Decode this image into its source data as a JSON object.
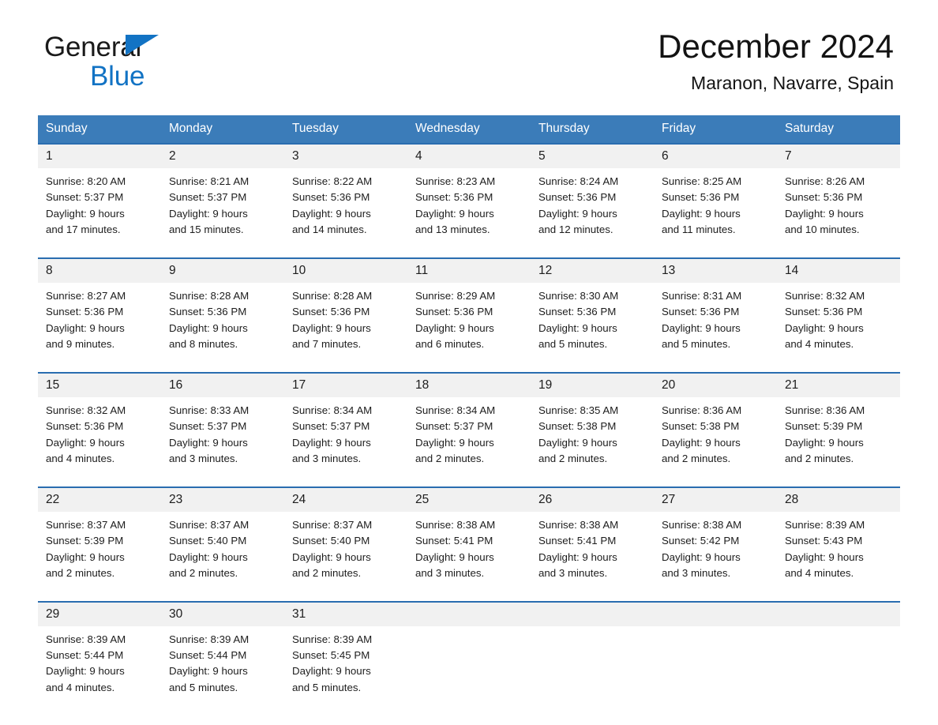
{
  "brand": {
    "name_part1": "General",
    "name_part2": "Blue",
    "logo_icon": "triangle-logo-icon"
  },
  "header": {
    "month_title": "December 2024",
    "location": "Maranon, Navarre, Spain"
  },
  "theme": {
    "header_blue": "#3b7cb9",
    "rule_blue": "#2a6db0",
    "daynum_band": "#f1f1f1",
    "brand_blue": "#1273c4",
    "text": "#1d1d1d"
  },
  "calendar": {
    "weekday_headers": [
      "Sunday",
      "Monday",
      "Tuesday",
      "Wednesday",
      "Thursday",
      "Friday",
      "Saturday"
    ],
    "weeks": [
      {
        "days": [
          {
            "num": "1",
            "sunrise": "Sunrise: 8:20 AM",
            "sunset": "Sunset: 5:37 PM",
            "daylight1": "Daylight: 9 hours",
            "daylight2": "and 17 minutes."
          },
          {
            "num": "2",
            "sunrise": "Sunrise: 8:21 AM",
            "sunset": "Sunset: 5:37 PM",
            "daylight1": "Daylight: 9 hours",
            "daylight2": "and 15 minutes."
          },
          {
            "num": "3",
            "sunrise": "Sunrise: 8:22 AM",
            "sunset": "Sunset: 5:36 PM",
            "daylight1": "Daylight: 9 hours",
            "daylight2": "and 14 minutes."
          },
          {
            "num": "4",
            "sunrise": "Sunrise: 8:23 AM",
            "sunset": "Sunset: 5:36 PM",
            "daylight1": "Daylight: 9 hours",
            "daylight2": "and 13 minutes."
          },
          {
            "num": "5",
            "sunrise": "Sunrise: 8:24 AM",
            "sunset": "Sunset: 5:36 PM",
            "daylight1": "Daylight: 9 hours",
            "daylight2": "and 12 minutes."
          },
          {
            "num": "6",
            "sunrise": "Sunrise: 8:25 AM",
            "sunset": "Sunset: 5:36 PM",
            "daylight1": "Daylight: 9 hours",
            "daylight2": "and 11 minutes."
          },
          {
            "num": "7",
            "sunrise": "Sunrise: 8:26 AM",
            "sunset": "Sunset: 5:36 PM",
            "daylight1": "Daylight: 9 hours",
            "daylight2": "and 10 minutes."
          }
        ]
      },
      {
        "days": [
          {
            "num": "8",
            "sunrise": "Sunrise: 8:27 AM",
            "sunset": "Sunset: 5:36 PM",
            "daylight1": "Daylight: 9 hours",
            "daylight2": "and 9 minutes."
          },
          {
            "num": "9",
            "sunrise": "Sunrise: 8:28 AM",
            "sunset": "Sunset: 5:36 PM",
            "daylight1": "Daylight: 9 hours",
            "daylight2": "and 8 minutes."
          },
          {
            "num": "10",
            "sunrise": "Sunrise: 8:28 AM",
            "sunset": "Sunset: 5:36 PM",
            "daylight1": "Daylight: 9 hours",
            "daylight2": "and 7 minutes."
          },
          {
            "num": "11",
            "sunrise": "Sunrise: 8:29 AM",
            "sunset": "Sunset: 5:36 PM",
            "daylight1": "Daylight: 9 hours",
            "daylight2": "and 6 minutes."
          },
          {
            "num": "12",
            "sunrise": "Sunrise: 8:30 AM",
            "sunset": "Sunset: 5:36 PM",
            "daylight1": "Daylight: 9 hours",
            "daylight2": "and 5 minutes."
          },
          {
            "num": "13",
            "sunrise": "Sunrise: 8:31 AM",
            "sunset": "Sunset: 5:36 PM",
            "daylight1": "Daylight: 9 hours",
            "daylight2": "and 5 minutes."
          },
          {
            "num": "14",
            "sunrise": "Sunrise: 8:32 AM",
            "sunset": "Sunset: 5:36 PM",
            "daylight1": "Daylight: 9 hours",
            "daylight2": "and 4 minutes."
          }
        ]
      },
      {
        "days": [
          {
            "num": "15",
            "sunrise": "Sunrise: 8:32 AM",
            "sunset": "Sunset: 5:36 PM",
            "daylight1": "Daylight: 9 hours",
            "daylight2": "and 4 minutes."
          },
          {
            "num": "16",
            "sunrise": "Sunrise: 8:33 AM",
            "sunset": "Sunset: 5:37 PM",
            "daylight1": "Daylight: 9 hours",
            "daylight2": "and 3 minutes."
          },
          {
            "num": "17",
            "sunrise": "Sunrise: 8:34 AM",
            "sunset": "Sunset: 5:37 PM",
            "daylight1": "Daylight: 9 hours",
            "daylight2": "and 3 minutes."
          },
          {
            "num": "18",
            "sunrise": "Sunrise: 8:34 AM",
            "sunset": "Sunset: 5:37 PM",
            "daylight1": "Daylight: 9 hours",
            "daylight2": "and 2 minutes."
          },
          {
            "num": "19",
            "sunrise": "Sunrise: 8:35 AM",
            "sunset": "Sunset: 5:38 PM",
            "daylight1": "Daylight: 9 hours",
            "daylight2": "and 2 minutes."
          },
          {
            "num": "20",
            "sunrise": "Sunrise: 8:36 AM",
            "sunset": "Sunset: 5:38 PM",
            "daylight1": "Daylight: 9 hours",
            "daylight2": "and 2 minutes."
          },
          {
            "num": "21",
            "sunrise": "Sunrise: 8:36 AM",
            "sunset": "Sunset: 5:39 PM",
            "daylight1": "Daylight: 9 hours",
            "daylight2": "and 2 minutes."
          }
        ]
      },
      {
        "days": [
          {
            "num": "22",
            "sunrise": "Sunrise: 8:37 AM",
            "sunset": "Sunset: 5:39 PM",
            "daylight1": "Daylight: 9 hours",
            "daylight2": "and 2 minutes."
          },
          {
            "num": "23",
            "sunrise": "Sunrise: 8:37 AM",
            "sunset": "Sunset: 5:40 PM",
            "daylight1": "Daylight: 9 hours",
            "daylight2": "and 2 minutes."
          },
          {
            "num": "24",
            "sunrise": "Sunrise: 8:37 AM",
            "sunset": "Sunset: 5:40 PM",
            "daylight1": "Daylight: 9 hours",
            "daylight2": "and 2 minutes."
          },
          {
            "num": "25",
            "sunrise": "Sunrise: 8:38 AM",
            "sunset": "Sunset: 5:41 PM",
            "daylight1": "Daylight: 9 hours",
            "daylight2": "and 3 minutes."
          },
          {
            "num": "26",
            "sunrise": "Sunrise: 8:38 AM",
            "sunset": "Sunset: 5:41 PM",
            "daylight1": "Daylight: 9 hours",
            "daylight2": "and 3 minutes."
          },
          {
            "num": "27",
            "sunrise": "Sunrise: 8:38 AM",
            "sunset": "Sunset: 5:42 PM",
            "daylight1": "Daylight: 9 hours",
            "daylight2": "and 3 minutes."
          },
          {
            "num": "28",
            "sunrise": "Sunrise: 8:39 AM",
            "sunset": "Sunset: 5:43 PM",
            "daylight1": "Daylight: 9 hours",
            "daylight2": "and 4 minutes."
          }
        ]
      },
      {
        "days": [
          {
            "num": "29",
            "sunrise": "Sunrise: 8:39 AM",
            "sunset": "Sunset: 5:44 PM",
            "daylight1": "Daylight: 9 hours",
            "daylight2": "and 4 minutes."
          },
          {
            "num": "30",
            "sunrise": "Sunrise: 8:39 AM",
            "sunset": "Sunset: 5:44 PM",
            "daylight1": "Daylight: 9 hours",
            "daylight2": "and 5 minutes."
          },
          {
            "num": "31",
            "sunrise": "Sunrise: 8:39 AM",
            "sunset": "Sunset: 5:45 PM",
            "daylight1": "Daylight: 9 hours",
            "daylight2": "and 5 minutes."
          },
          {
            "num": "",
            "sunrise": "",
            "sunset": "",
            "daylight1": "",
            "daylight2": ""
          },
          {
            "num": "",
            "sunrise": "",
            "sunset": "",
            "daylight1": "",
            "daylight2": ""
          },
          {
            "num": "",
            "sunrise": "",
            "sunset": "",
            "daylight1": "",
            "daylight2": ""
          },
          {
            "num": "",
            "sunrise": "",
            "sunset": "",
            "daylight1": "",
            "daylight2": ""
          }
        ]
      }
    ]
  }
}
